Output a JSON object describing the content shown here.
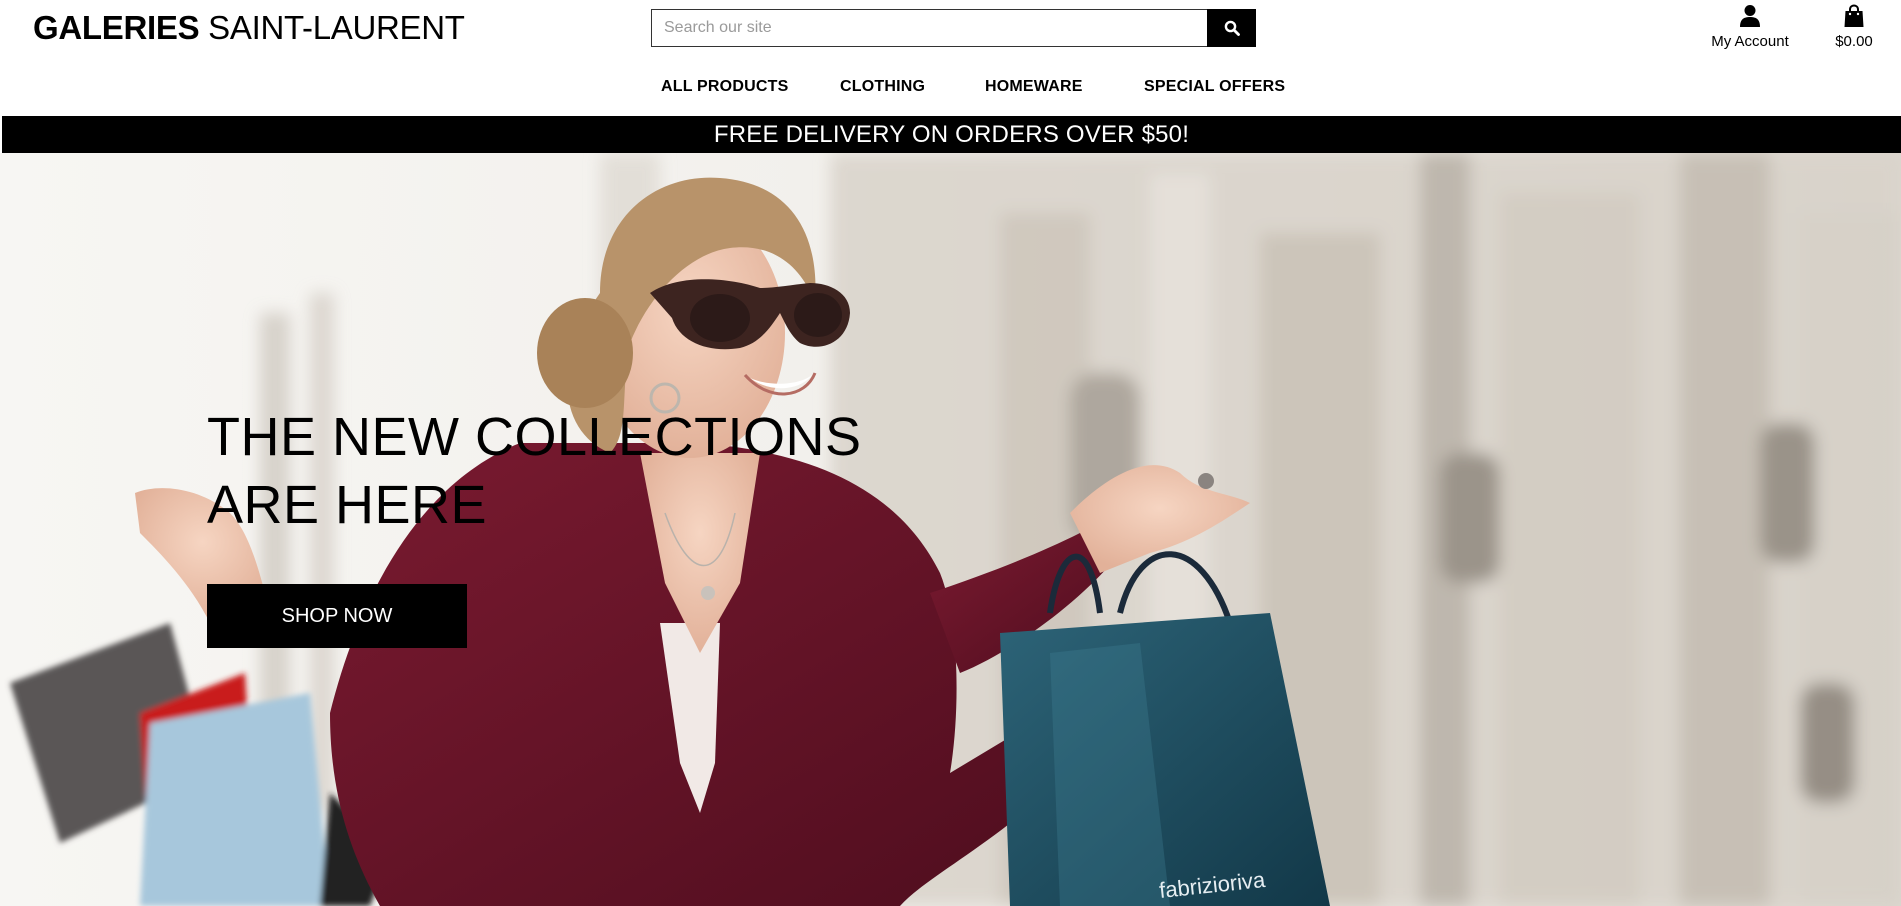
{
  "brand": {
    "bold": "GALERIES",
    "light": " SAINT-LAURENT"
  },
  "search": {
    "placeholder": "Search our site",
    "value": ""
  },
  "account": {
    "label": "My Account"
  },
  "cart": {
    "total": "$0.00"
  },
  "nav": {
    "items": [
      {
        "label": "ALL PRODUCTS"
      },
      {
        "label": "CLOTHING"
      },
      {
        "label": "HOMEWARE"
      },
      {
        "label": "SPECIAL OFFERS"
      }
    ]
  },
  "banner": {
    "text": "FREE DELIVERY ON ORDERS OVER $50!"
  },
  "hero": {
    "title_line1": "THE NEW COLLECTIONS",
    "title_line2": "ARE HERE",
    "cta_label": "SHOP NOW"
  },
  "icons": {
    "search": "search-icon",
    "account": "user-icon",
    "cart": "shopping-bag-icon"
  },
  "colors": {
    "primary": "#000000",
    "background": "#ffffff",
    "banner_text": "#ffffff",
    "hero_dress": "#6a1428",
    "hero_bag": "#1f4f63"
  }
}
